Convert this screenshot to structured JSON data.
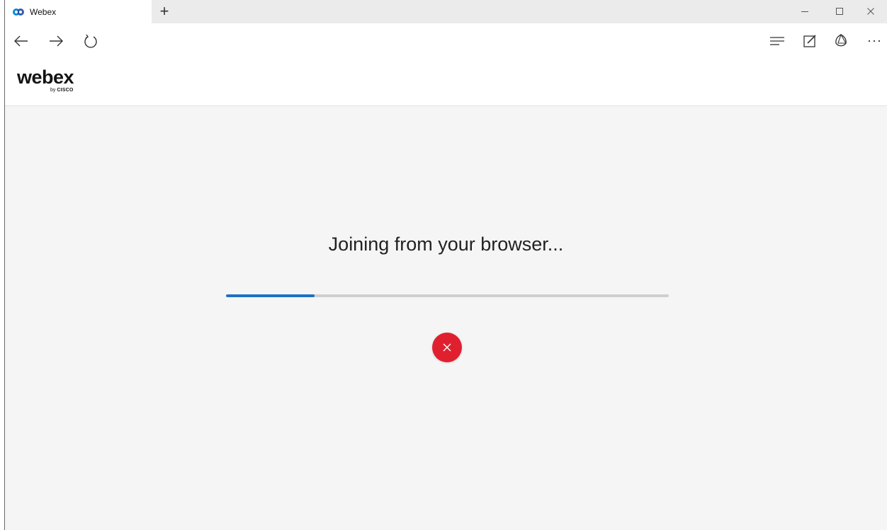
{
  "browser": {
    "tab_title": "Webex",
    "new_tab_symbol": "+"
  },
  "page": {
    "logo_word": "webex",
    "logo_by": "by",
    "logo_cisco": "CISCO",
    "status_text": "Joining from your browser...",
    "progress_fraction": 0.2
  },
  "icons": {
    "favicon": "webex-favicon-icon",
    "back": "arrow-left-icon",
    "forward": "arrow-right-icon",
    "refresh": "refresh-icon",
    "hub": "reading-list-icon",
    "notes": "web-note-icon",
    "share": "share-icon",
    "more": "more-icon",
    "cancel": "close-icon"
  },
  "colors": {
    "accent": "#1f6fc6",
    "cancel": "#e0202f",
    "content_bg": "#f5f5f5"
  }
}
